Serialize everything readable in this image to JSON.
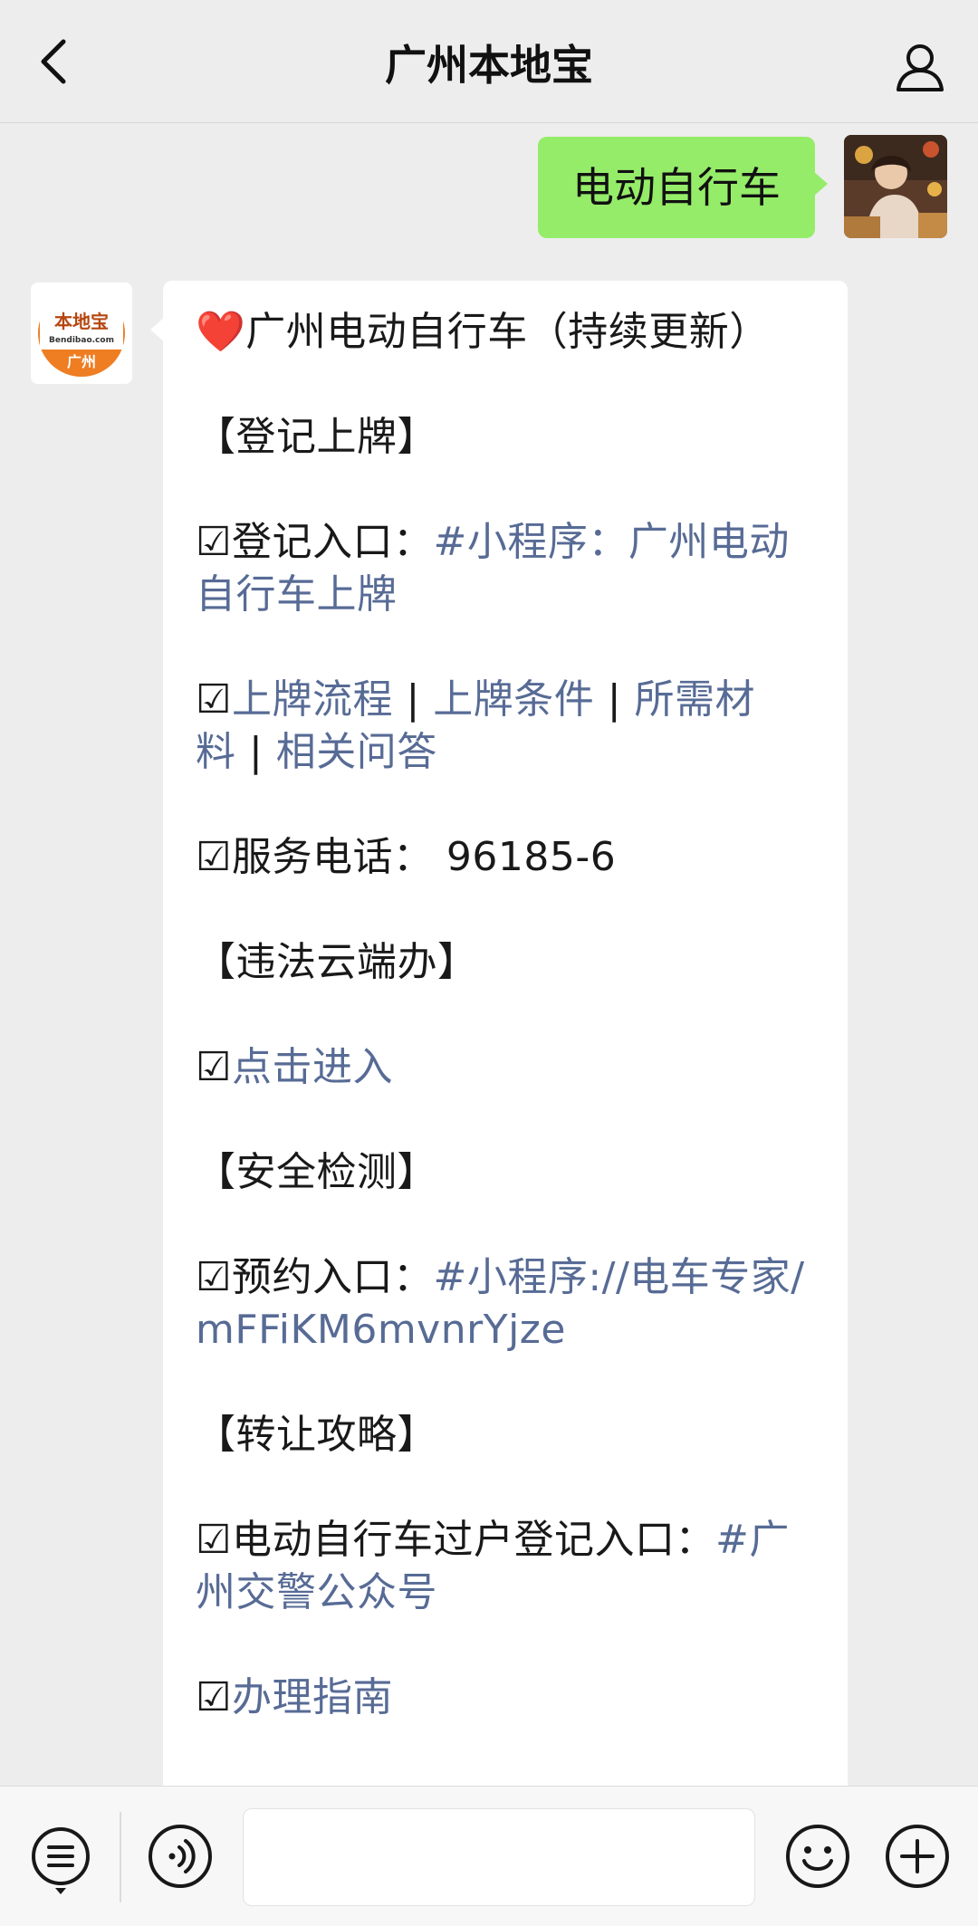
{
  "header": {
    "title": "广州本地宝",
    "back_icon": "chevron-left-icon",
    "profile_icon": "person-icon"
  },
  "me": {
    "message": "电动自行车"
  },
  "bot": {
    "avatar_text_top": "本地宝",
    "avatar_text_mid": "Bendibao.com",
    "avatar_text_bottom": "广州",
    "title_rest": "广州电动自行车（持续更新）",
    "section1": "【登记上牌】",
    "reg_prefix": "☑登记入口：",
    "reg_link_line1": "#小程序：广州电动",
    "reg_link_line2": "自行车上牌",
    "check_mark": "☑",
    "link_flow": "上牌流程",
    "link_conditions": "上牌条件",
    "link_materials_a": "所需材",
    "link_materials_b": "料",
    "link_qa": "相关问答",
    "pipe": " | ",
    "phone": "☑服务电话：  96185-6",
    "section2": "【违法云端办】",
    "link_enter": "点击进入",
    "section3": "【安全检测】",
    "appt_prefix": "☑预约入口：",
    "appt_link_line1": "#小程序://电车专家/",
    "appt_link_line2": "mFFiKM6mvnrYjze",
    "section4": "【转让攻略】",
    "transfer_prefix": "☑电动自行车过户登记入口：",
    "transfer_link_a": "#广",
    "transfer_link_b": "州交警公众号",
    "link_guide": "办理指南"
  },
  "colors": {
    "link": "#576b95",
    "me_bubble": "#95ec69",
    "background": "#ededed"
  },
  "bottom_bar": {
    "menu_icon": "menu-list-icon",
    "voice_icon": "voice-icon",
    "emoji_icon": "emoji-icon",
    "plus_icon": "plus-icon",
    "input_value": ""
  }
}
